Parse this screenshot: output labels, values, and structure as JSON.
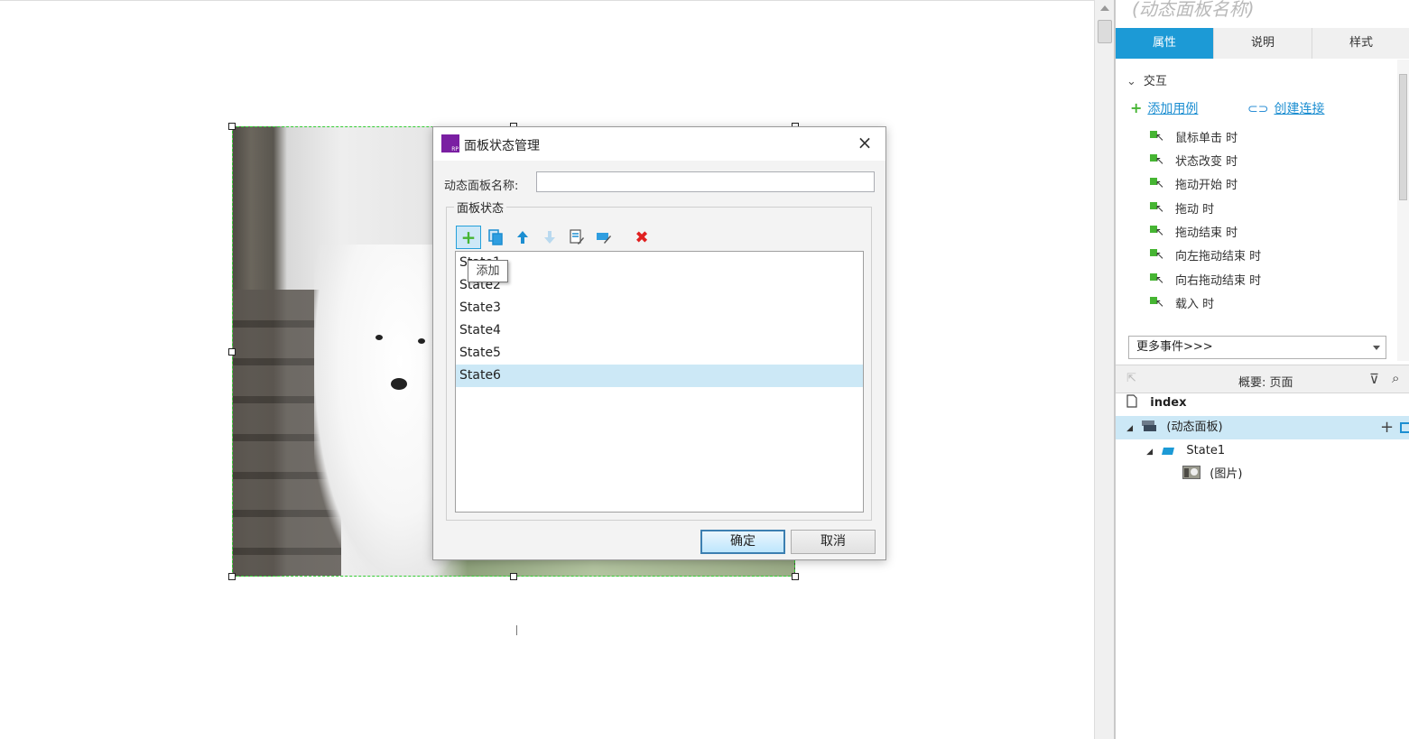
{
  "canvas": {
    "widget": "photo-of-white-puppy"
  },
  "dialog": {
    "title": "面板状态管理",
    "close_glyph": "×",
    "name_label": "动态面板名称:",
    "name_value": "",
    "group_title": "面板状态",
    "toolbar": {
      "add_tooltip": "添加"
    },
    "states": [
      "State1",
      "State2",
      "State3",
      "State4",
      "State5",
      "State6"
    ],
    "selected_state": "State6",
    "ok_label": "确定",
    "cancel_label": "取消"
  },
  "panel": {
    "widget_name": "(动态面板名称)",
    "tabs": [
      "属性",
      "说明",
      "样式"
    ],
    "active_tab": "属性",
    "interaction_section": "交互",
    "add_case_label": "添加用例",
    "create_link_label": "创建连接",
    "events": [
      "鼠标单击 时",
      "状态改变 时",
      "拖动开始 时",
      "拖动 时",
      "拖动结束 时",
      "向左拖动结束 时",
      "向右拖动结束 时",
      "载入 时"
    ],
    "more_events": "更多事件>>>",
    "outline_title": "概要: 页面",
    "tree": {
      "page": "index",
      "panel": "(动态面板)",
      "state": "State1",
      "image": "(图片)"
    },
    "colors": {
      "accent": "#1c9ad6",
      "selected_row": "#cce8f6",
      "add_green": "#46b533"
    }
  }
}
